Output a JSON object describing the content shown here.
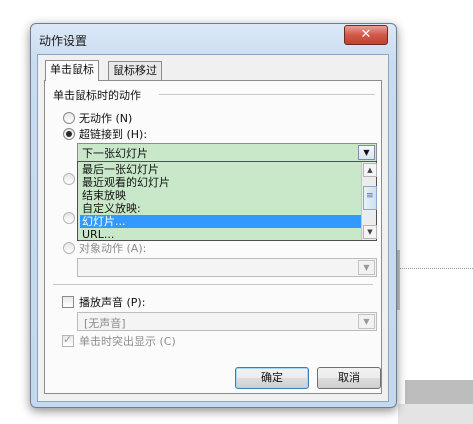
{
  "window": {
    "title": "动作设置",
    "close_glyph": "✕"
  },
  "tabs": [
    {
      "label": "单击鼠标"
    },
    {
      "label": "鼠标移过"
    }
  ],
  "group": {
    "label": "单击鼠标时的动作"
  },
  "radios": {
    "none": {
      "label": "无动作 (N)"
    },
    "hyperlink": {
      "label": "超链接到 (H):"
    },
    "object_action": {
      "label": "对象动作 (A):"
    }
  },
  "hyperlink_combo": {
    "value": "下一张幻灯片"
  },
  "dropdown": {
    "items": [
      "最后一张幻灯片",
      "最近观看的幻灯片",
      "结束放映",
      "自定义放映:",
      "幻灯片...",
      "URL..."
    ],
    "selected_index": 4
  },
  "sound": {
    "checkbox_label": "播放声音 (P):",
    "value": "[无声音]"
  },
  "highlight": {
    "label": "单击时突出显示 (C)"
  },
  "buttons": {
    "ok": "确定",
    "cancel": "取消"
  },
  "icons": {
    "dropdown_arrow": "▼",
    "scroll_up": "▲",
    "scroll_down": "▼"
  }
}
